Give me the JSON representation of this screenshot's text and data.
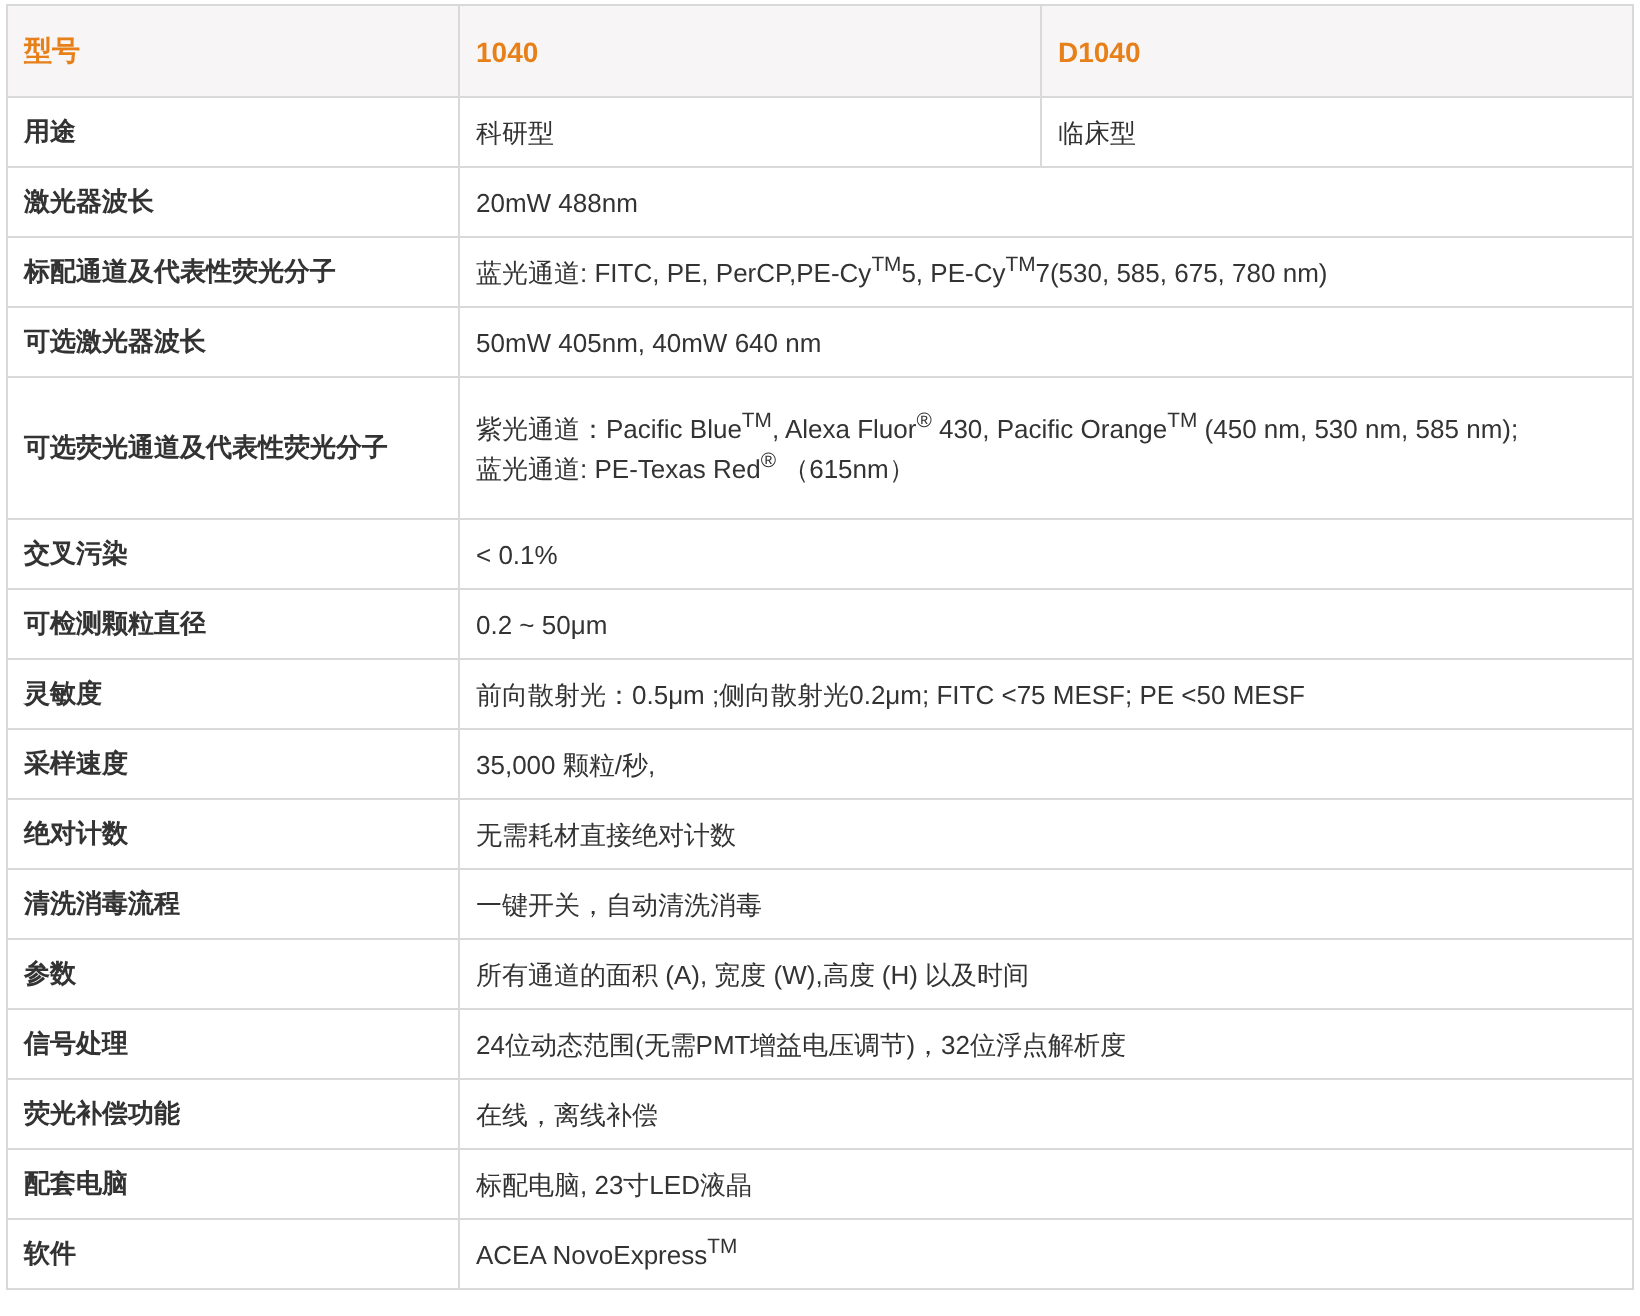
{
  "table": {
    "header": [
      "型号",
      "1040",
      "D1040"
    ],
    "rows": [
      {
        "label": "用途",
        "cells": [
          {
            "lines": [
              "科研型"
            ]
          },
          {
            "lines": [
              "临床型"
            ]
          }
        ]
      },
      {
        "label": "激光器波长",
        "cells": [
          {
            "colspan": 2,
            "lines": [
              "20mW 488nm"
            ]
          }
        ]
      },
      {
        "label": "标配通道及代表性荧光分子",
        "cells": [
          {
            "colspan": 2,
            "lines": [
              "蓝光通道: FITC, PE, PerCP,PE-Cy$^{TM}$5, PE-Cy$^{TM}$7(530, 585, 675, 780 nm)"
            ]
          }
        ]
      },
      {
        "label": "可选激光器波长",
        "cells": [
          {
            "colspan": 2,
            "lines": [
              "50mW 405nm, 40mW 640 nm"
            ]
          }
        ]
      },
      {
        "label": "可选荧光通道及代表性荧光分子",
        "cells": [
          {
            "colspan": 2,
            "lines": [
              "紫光通道：Pacific Blue$^{TM}$, Alexa Fluor$^{®}$ 430, Pacific Orange$^{TM}$ (450 nm, 530 nm, 585 nm);",
              "蓝光通道:  PE-Texas Red$^{®}$ （615nm）"
            ]
          }
        ]
      },
      {
        "label": "交叉污染",
        "cells": [
          {
            "colspan": 2,
            "lines": [
              "< 0.1%"
            ]
          }
        ]
      },
      {
        "label": "可检测颗粒直径",
        "cells": [
          {
            "colspan": 2,
            "lines": [
              "0.2 ~ 50μm"
            ]
          }
        ]
      },
      {
        "label": "灵敏度",
        "cells": [
          {
            "colspan": 2,
            "lines": [
              "前向散射光：0.5μm ;侧向散射光0.2μm; FITC <75 MESF; PE <50 MESF"
            ]
          }
        ]
      },
      {
        "label": "采样速度",
        "cells": [
          {
            "colspan": 2,
            "lines": [
              "35,000 颗粒/秒,"
            ]
          }
        ]
      },
      {
        "label": "绝对计数",
        "cells": [
          {
            "colspan": 2,
            "lines": [
              "无需耗材直接绝对计数"
            ]
          }
        ]
      },
      {
        "label": "清洗消毒流程",
        "cells": [
          {
            "colspan": 2,
            "lines": [
              "一键开关，自动清洗消毒"
            ]
          }
        ]
      },
      {
        "label": "参数",
        "cells": [
          {
            "colspan": 2,
            "lines": [
              "所有通道的面积 (A), 宽度 (W),高度 (H) 以及时间"
            ]
          }
        ]
      },
      {
        "label": "信号处理",
        "cells": [
          {
            "colspan": 2,
            "lines": [
              "24位动态范围(无需PMT增益电压调节)，32位浮点解析度"
            ]
          }
        ]
      },
      {
        "label": "荧光补偿功能",
        "cells": [
          {
            "colspan": 2,
            "lines": [
              "在线，离线补偿"
            ]
          }
        ]
      },
      {
        "label": "配套电脑",
        "cells": [
          {
            "colspan": 2,
            "lines": [
              "标配电脑, 23寸LED液晶"
            ]
          }
        ]
      },
      {
        "label": "软件",
        "cells": [
          {
            "colspan": 2,
            "lines": [
              "ACEA NovoExpress$^{TM}$"
            ]
          }
        ]
      }
    ]
  }
}
